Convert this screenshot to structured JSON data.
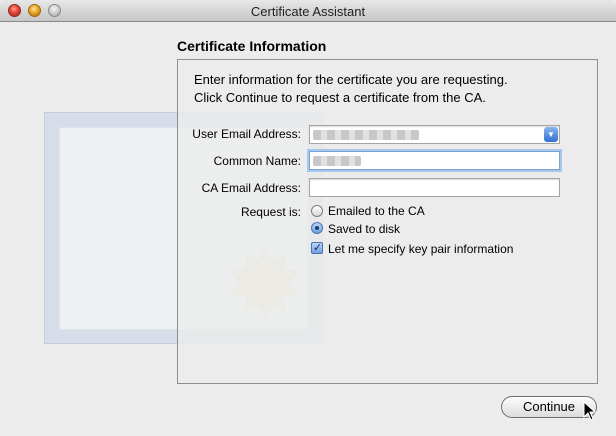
{
  "window": {
    "title": "Certificate Assistant"
  },
  "section": {
    "title": "Certificate Information"
  },
  "intro": {
    "line1": "Enter information for the certificate you are requesting.",
    "line2": "Click Continue to request a certificate from the CA."
  },
  "form": {
    "user_email_label": "User Email Address:",
    "common_name_label": "Common Name:",
    "ca_email_label": "CA Email Address:",
    "request_label": "Request is:",
    "ca_email_value": "",
    "options": {
      "emailed": "Emailed to the CA",
      "saved": "Saved to disk",
      "keypair": "Let me specify key pair information"
    },
    "selected_request": "Saved to disk",
    "keypair_checked": true
  },
  "buttons": {
    "continue": "Continue"
  },
  "icons": {
    "close": "close-icon",
    "minimize": "minimize-icon",
    "zoom": "zoom-icon",
    "popup": "chevron-down-icon",
    "cursor": "pointer-cursor-icon",
    "seal": "seal-icon"
  }
}
